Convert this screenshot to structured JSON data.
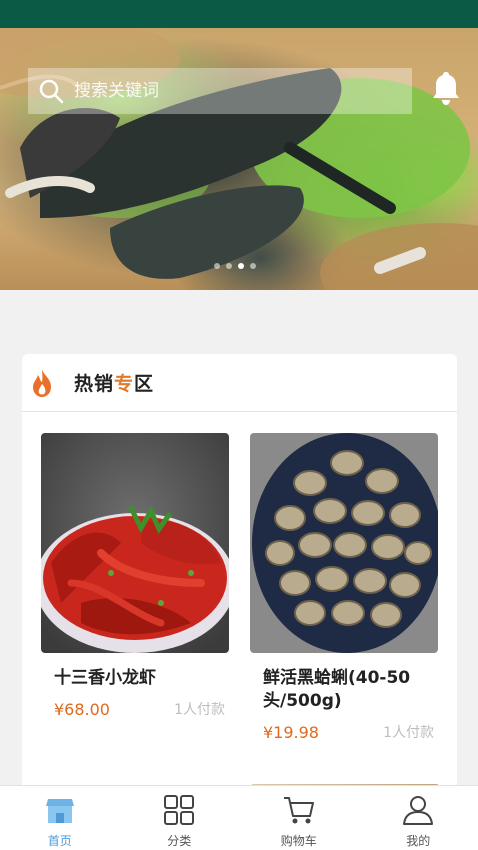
{
  "search": {
    "placeholder": "搜索关键词"
  },
  "banner": {
    "slides": 4,
    "active_slide": 3
  },
  "hot_section": {
    "title_parts": [
      "热销",
      "专",
      "区"
    ],
    "products": [
      {
        "name": "十三香小龙虾",
        "price": "¥68.00",
        "buyers": "1人付款",
        "image": "spicy-crayfish"
      },
      {
        "name": "鲜活黑蛤蜊(40-50头/500g)",
        "price": "¥19.98",
        "buyers": "1人付款",
        "image": "black-clams"
      }
    ]
  },
  "tabbar": [
    {
      "label": "首页",
      "icon": "home-icon",
      "active": true
    },
    {
      "label": "分类",
      "icon": "category-grid-icon",
      "active": false
    },
    {
      "label": "购物车",
      "icon": "cart-icon",
      "active": false
    },
    {
      "label": "我的",
      "icon": "user-icon",
      "active": false
    }
  ],
  "colors": {
    "status_bar": "#0b5a46",
    "accent_price": "#e06a1e",
    "tab_active": "#4d9ad6",
    "highlight": "#e07a2b"
  }
}
